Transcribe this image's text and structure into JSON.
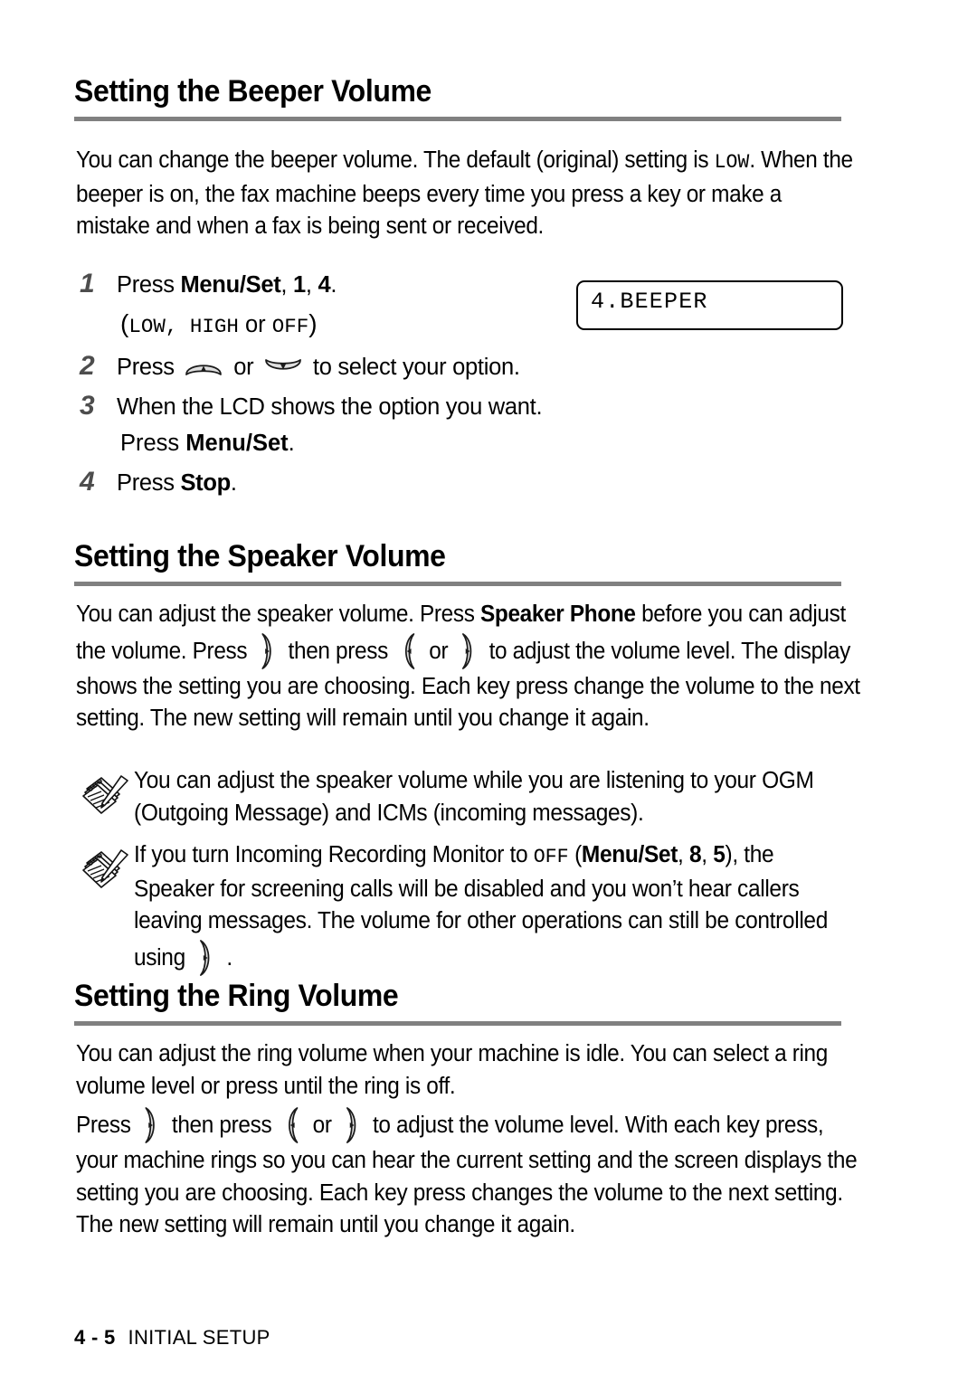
{
  "document": {
    "footer": {
      "page_number": "4 - 5",
      "chapter_title": "INITIAL SETUP"
    }
  },
  "sections": [
    {
      "heading": "Setting the Beeper Volume",
      "intro_part1": "You can change the beeper volume. The default (original) setting is ",
      "intro_mono": "LOW",
      "intro_part2": ". When the beeper is on, the fax machine beeps every time you press a key or make a mistake and when a fax is being sent or received.",
      "steps": [
        {
          "number": "1",
          "text_pre": "Press ",
          "bold_1": "Menu/Set",
          "text_mid": ", ",
          "bold_2": "1",
          "text_mid2": ", ",
          "bold_3": "4",
          "text_post": ".",
          "sub_open": "(",
          "sub_mono_1": "LOW",
          "sub_sep_1": ", ",
          "sub_mono_2": "HIGH",
          "sub_or": " or ",
          "sub_mono_3": "OFF",
          "sub_close": ")"
        },
        {
          "number": "2",
          "text_pre": "Press ",
          "icon_1": "arrow-up-key-icon",
          "text_mid": " or ",
          "icon_2": "arrow-down-key-icon",
          "text_post": " to select your option."
        },
        {
          "number": "3",
          "text_pre": "When the LCD shows the option you want.",
          "sub_pre": "Press ",
          "sub_bold": "Menu/Set",
          "sub_post": "."
        },
        {
          "number": "4",
          "text_pre": "Press ",
          "bold_1": "Stop",
          "text_post": "."
        }
      ],
      "lcd_display": "4.BEEPER"
    },
    {
      "heading": "Setting the Speaker Volume",
      "paragraph": {
        "p1": "You can adjust the speaker volume. Press ",
        "bold_1": "Speaker Phone",
        "p2": " before you can adjust the volume. Press ",
        "icon_1": "arrow-right-key-icon",
        "p3": " then press ",
        "icon_2": "arrow-left-key-icon",
        "p4": " or ",
        "icon_3": "arrow-right-key-icon",
        "p5": " to adjust the volume level. The display shows the setting you are choosing. Each key press change the volume to the next setting. The new setting will remain until you change it again."
      },
      "notes": [
        {
          "icon": "note-pad-pencil-icon",
          "text": "You can adjust the speaker volume while you are listening to your OGM (Outgoing Message) and ICMs (incoming messages)."
        },
        {
          "icon": "note-pad-pencil-icon",
          "p1": "If you turn Incoming Recording Monitor to ",
          "mono_1": "OFF",
          "p2": " (",
          "bold_1": "Menu/Set",
          "p3": ", ",
          "bold_2": "8",
          "p4": ", ",
          "bold_3": "5",
          "p5": "), the Speaker for screening calls will be disabled and you won’t hear callers leaving messages. The volume for other operations can still be controlled using ",
          "icon_1": "arrow-right-key-icon",
          "p6": " ."
        }
      ]
    },
    {
      "heading": "Setting the Ring Volume",
      "paragraph_1": "You can adjust the ring volume when your machine is idle. You can select a ring volume level or press until the ring is off.",
      "paragraph_2": {
        "p1": "Press ",
        "icon_1": "arrow-right-key-icon",
        "p2": " then press ",
        "icon_2": "arrow-left-key-icon",
        "p3": " or ",
        "icon_3": "arrow-right-key-icon",
        "p4": " to adjust the volume level. With each key press, your machine rings so you can hear the current setting and the screen displays the setting you are choosing. Each key press changes the volume to the next setting. The new setting will remain until you change it again."
      }
    }
  ],
  "colors": {
    "rule": "#808080",
    "step_number": "#4d4d4d",
    "key_fill": "#e0e0e0",
    "text": "#000000"
  }
}
